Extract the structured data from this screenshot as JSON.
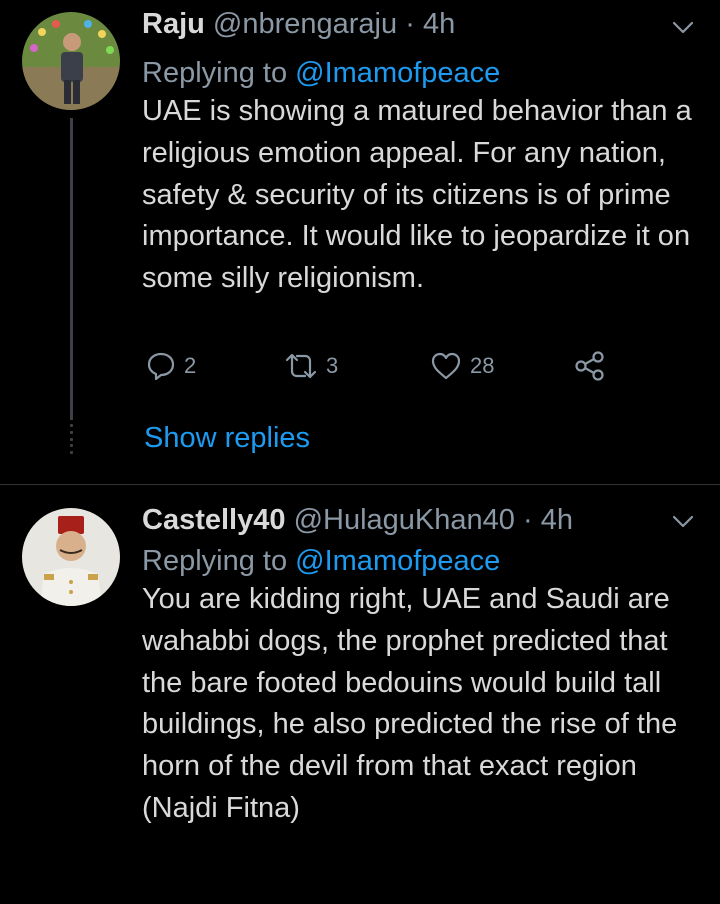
{
  "tweets": [
    {
      "display_name": "Raju",
      "handle": "@nbrengaraju",
      "separator": "·",
      "time": "4h",
      "replying_prefix": "Replying to",
      "replying_to": "@Imamofpeace",
      "body": "UAE is showing a matured behavior than a religious emotion appeal. For any nation, safety & security of its citizens is of prime importance. It would like to jeopardize it on some silly religionism.",
      "actions": {
        "reply_count": "2",
        "retweet_count": "3",
        "like_count": "28"
      },
      "show_replies": "Show replies"
    },
    {
      "display_name": "Castelly40",
      "handle": "@HulaguKhan40",
      "separator": "·",
      "time": "4h",
      "replying_prefix": "Replying to",
      "replying_to": "@Imamofpeace",
      "body": "You are kidding right, UAE and Saudi are wahabbi dogs, the prophet predicted that the bare footed bedouins would build tall buildings, he also predicted the rise of the horn of the devil from that exact region (Najdi Fitna)"
    }
  ],
  "colors": {
    "background": "#000000",
    "text": "#d9d9d9",
    "secondary": "#8b98a5",
    "accent": "#1d9bf0",
    "divider": "#2f3336"
  },
  "icons": {
    "reply": "reply-icon",
    "retweet": "retweet-icon",
    "like": "like-icon",
    "share": "share-icon",
    "more": "chevron-down-icon"
  }
}
